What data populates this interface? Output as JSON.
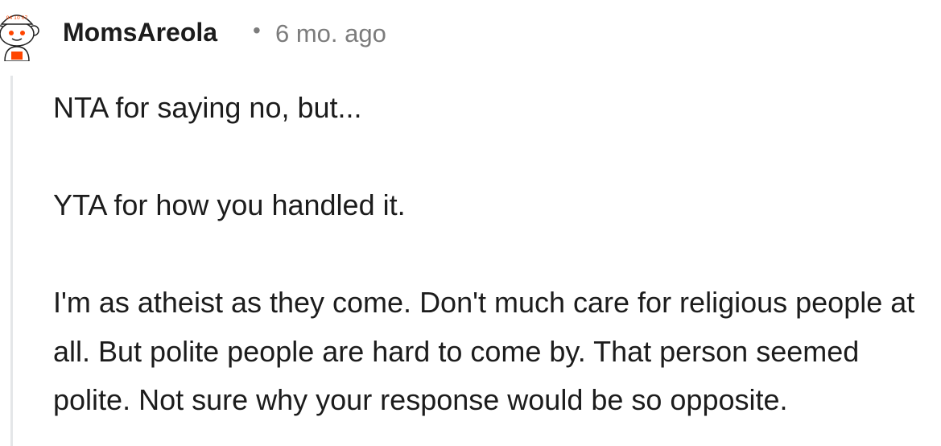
{
  "comment": {
    "author": "MomsAreola",
    "separator": "•",
    "timestamp": "6 mo. ago",
    "avatar_badge_text": "04 10 07",
    "paragraphs": [
      "NTA for saying no, but...",
      "YTA for how you handled it.",
      "I'm as atheist as they come. Don't much care for religious people at all. But polite people are hard to come by. That person seemed polite. Not sure why your response would be so opposite."
    ]
  },
  "colors": {
    "text": "#1c1c1c",
    "meta": "#7c7c7c",
    "thread_line": "#e4e6e8",
    "avatar_accent": "#ff4500"
  },
  "icons": {
    "avatar": "snoo-avatar-icon"
  }
}
